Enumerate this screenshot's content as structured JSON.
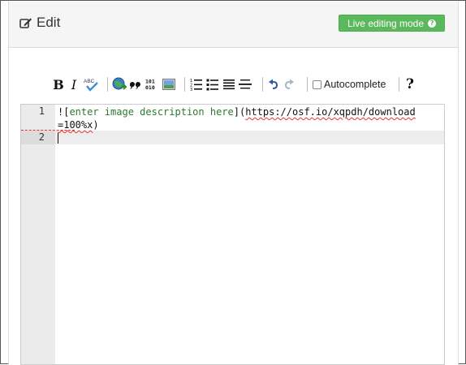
{
  "header": {
    "title": "Edit",
    "live_button": "Live editing mode"
  },
  "toolbar": {
    "autocomplete_label": "Autocomplete",
    "autocomplete_checked": false,
    "help_label": "?",
    "bold_label": "B",
    "italic_label": "I",
    "spell_label": "ABC",
    "binary_top": "101",
    "binary_bottom": "010"
  },
  "editor": {
    "gutter": [
      "1",
      "2"
    ],
    "line1_open": "![",
    "line1_alt": "enter image description here",
    "line1_close": "](",
    "line1_url": "https://osf.io/xqpdh/download",
    "line1_wrap": "=100%x",
    "line1_end": ")",
    "line2": ""
  },
  "colors": {
    "live_button": "#5cb85c",
    "heading_bg": "#f5f5f5",
    "gutter_bg": "#ebebeb",
    "link_text": "#2b7a2b"
  }
}
